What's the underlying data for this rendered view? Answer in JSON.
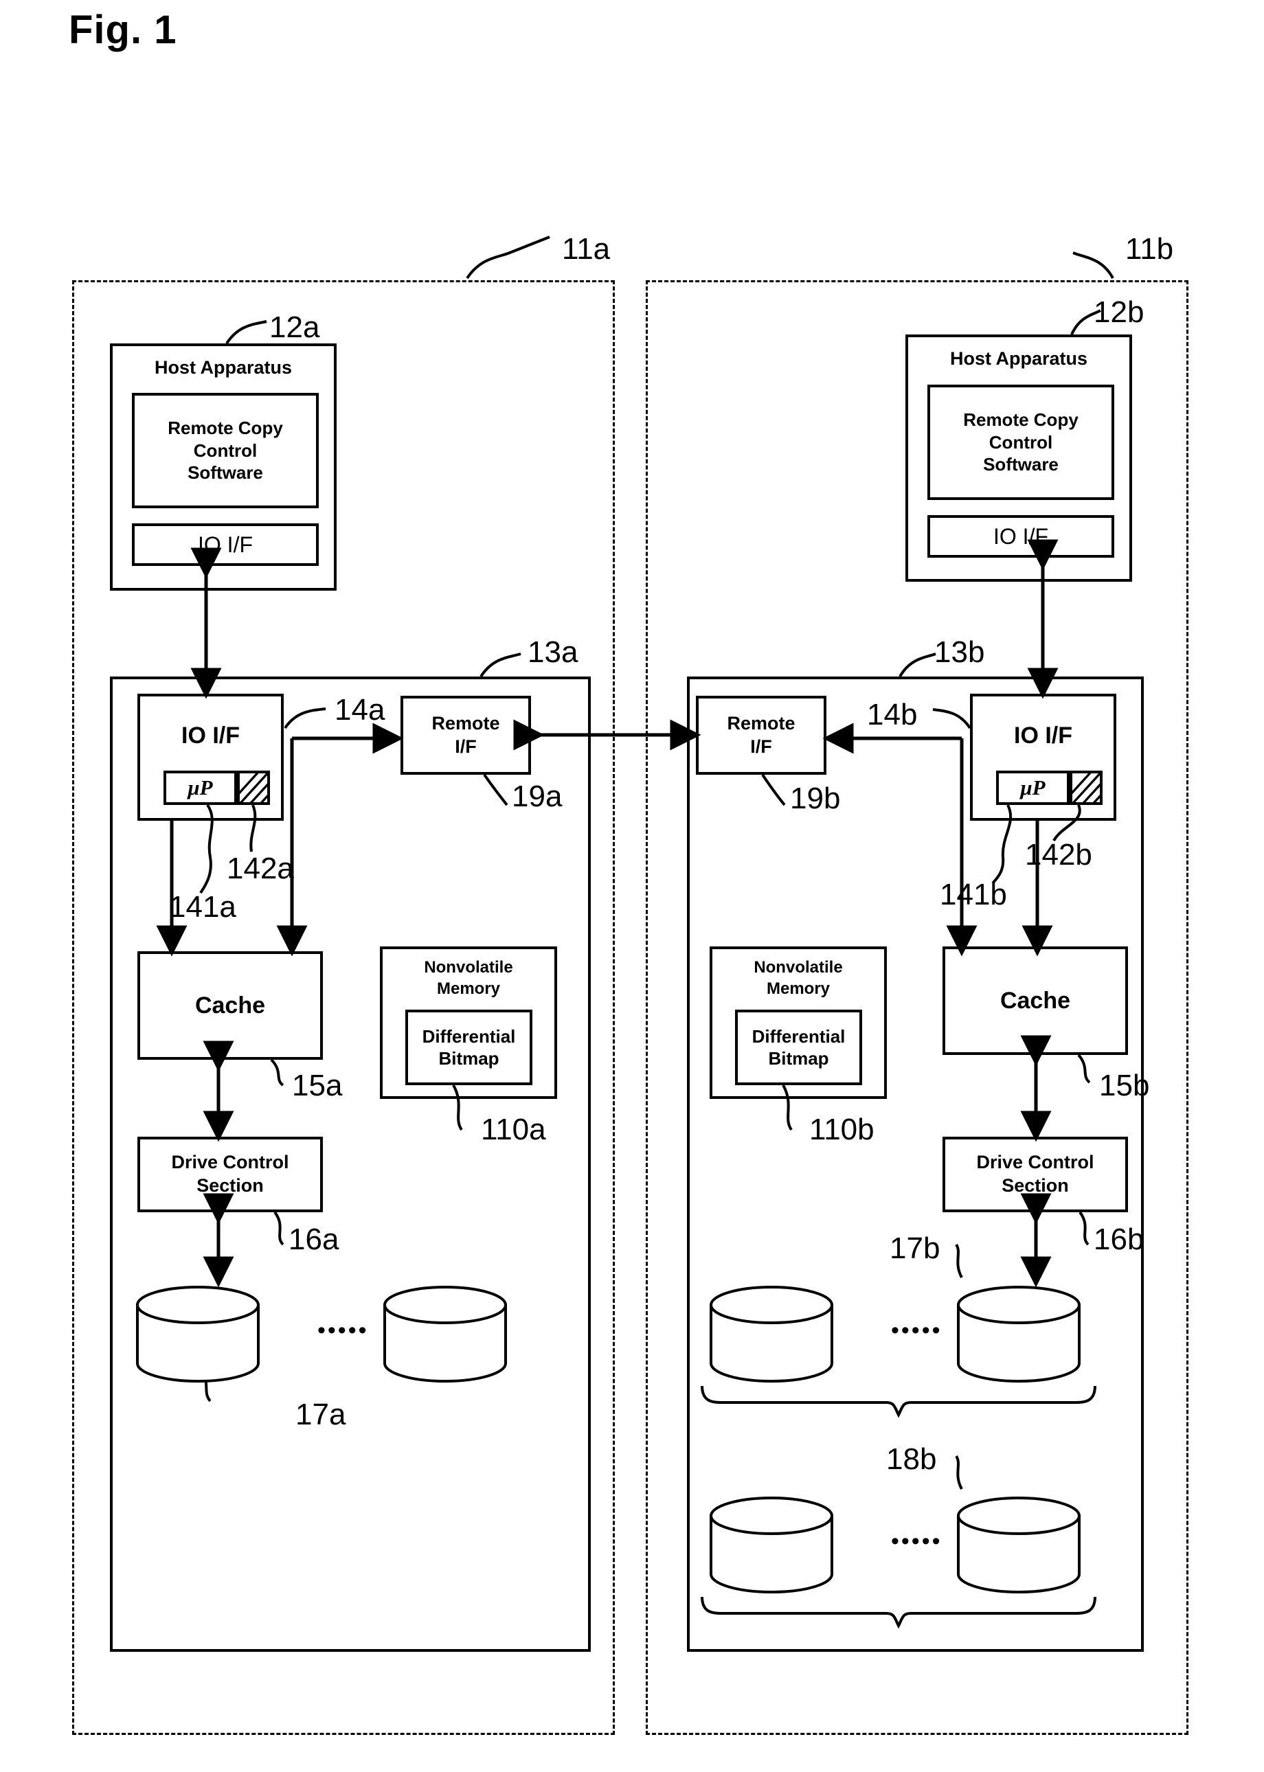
{
  "figure": {
    "title": "Fig. 1"
  },
  "systems": [
    {
      "id": "left",
      "site_ref": "11a",
      "host": {
        "ref": "12a",
        "title": "Host Apparatus",
        "software": "Remote Copy\nControl\nSoftware",
        "software_lines": [
          "Remote Copy",
          "Control",
          "Software"
        ],
        "io_if": "IO  I/F"
      },
      "controller": {
        "ref": "13a",
        "io_if": {
          "ref": "14a",
          "label": "IO  I/F"
        },
        "microprocessor": {
          "ref": "141a",
          "label": "μP"
        },
        "hatched_memory": {
          "ref": "142a",
          "label": ""
        },
        "remote_if": {
          "ref": "19a",
          "lines": [
            "Remote",
            "I/F"
          ]
        },
        "cache": {
          "ref": "15a",
          "label": "Cache"
        },
        "nonvolatile_memory": {
          "ref": "110a",
          "title_lines": [
            "Nonvolatile",
            "Memory"
          ],
          "inner_lines": [
            "Differential",
            "Bitmap"
          ]
        },
        "drive_control": {
          "ref": "16a",
          "lines": [
            "Drive Control",
            "Section"
          ]
        },
        "disk_groups": [
          {
            "ref": "17a",
            "brace_ref": "",
            "disks": [
              "Disk",
              "Disk"
            ],
            "ellipsis": "•••••"
          }
        ]
      }
    },
    {
      "id": "right",
      "site_ref": "11b",
      "host": {
        "ref": "12b",
        "title": "Host Apparatus",
        "software": "Remote Copy\nControl\nSoftware",
        "software_lines": [
          "Remote Copy",
          "Control",
          "Software"
        ],
        "io_if": "IO  I/F"
      },
      "controller": {
        "ref": "13b",
        "io_if": {
          "ref": "14b",
          "label": "IO  I/F"
        },
        "microprocessor": {
          "ref": "141b",
          "label": "μP"
        },
        "hatched_memory": {
          "ref": "142b",
          "label": ""
        },
        "remote_if": {
          "ref": "19b",
          "lines": [
            "Remote",
            "I/F"
          ]
        },
        "cache": {
          "ref": "15b",
          "label": "Cache"
        },
        "nonvolatile_memory": {
          "ref": "110b",
          "title_lines": [
            "Nonvolatile",
            "Memory"
          ],
          "inner_lines": [
            "Differential",
            "Bitmap"
          ]
        },
        "drive_control": {
          "ref": "16b",
          "lines": [
            "Drive Control",
            "Section"
          ]
        },
        "disk_groups": [
          {
            "ref": "17b",
            "brace_ref": "",
            "disks": [
              "Disk",
              "Disk"
            ],
            "ellipsis": "•••••"
          },
          {
            "ref": "18b",
            "brace_ref": "",
            "disks": [
              "Disk",
              "Disk"
            ],
            "ellipsis": "•••••"
          }
        ]
      }
    }
  ],
  "colors": {
    "ink": "#000000",
    "paper": "#ffffff"
  }
}
